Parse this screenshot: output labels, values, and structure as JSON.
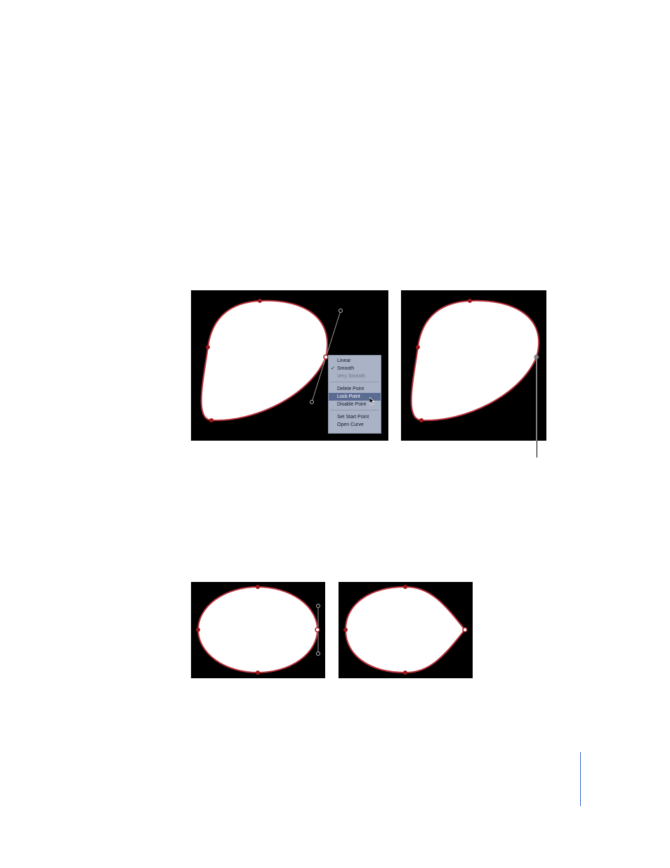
{
  "context_menu": {
    "items": [
      {
        "label": "Linear",
        "checked": false,
        "enabled": true
      },
      {
        "label": "Smooth",
        "checked": true,
        "enabled": true
      },
      {
        "label": "Very Smooth",
        "checked": false,
        "enabled": false
      },
      {
        "label": "Delete Point",
        "checked": false,
        "enabled": true
      },
      {
        "label": "Lock Point",
        "checked": false,
        "enabled": true,
        "highlighted": true
      },
      {
        "label": "Disable Point",
        "checked": false,
        "enabled": true
      },
      {
        "label": "Set Start Point",
        "checked": false,
        "enabled": true
      },
      {
        "label": "Open Curve",
        "checked": false,
        "enabled": true
      }
    ],
    "check_glyph": "✓"
  },
  "colors": {
    "panel_bg": "#000000",
    "shape_fill": "#ffffff",
    "outline": "#b8303a",
    "control_point": "#a0181e",
    "tangent_handle": "#9a9a9a",
    "page_rule": "#2a63c9"
  }
}
